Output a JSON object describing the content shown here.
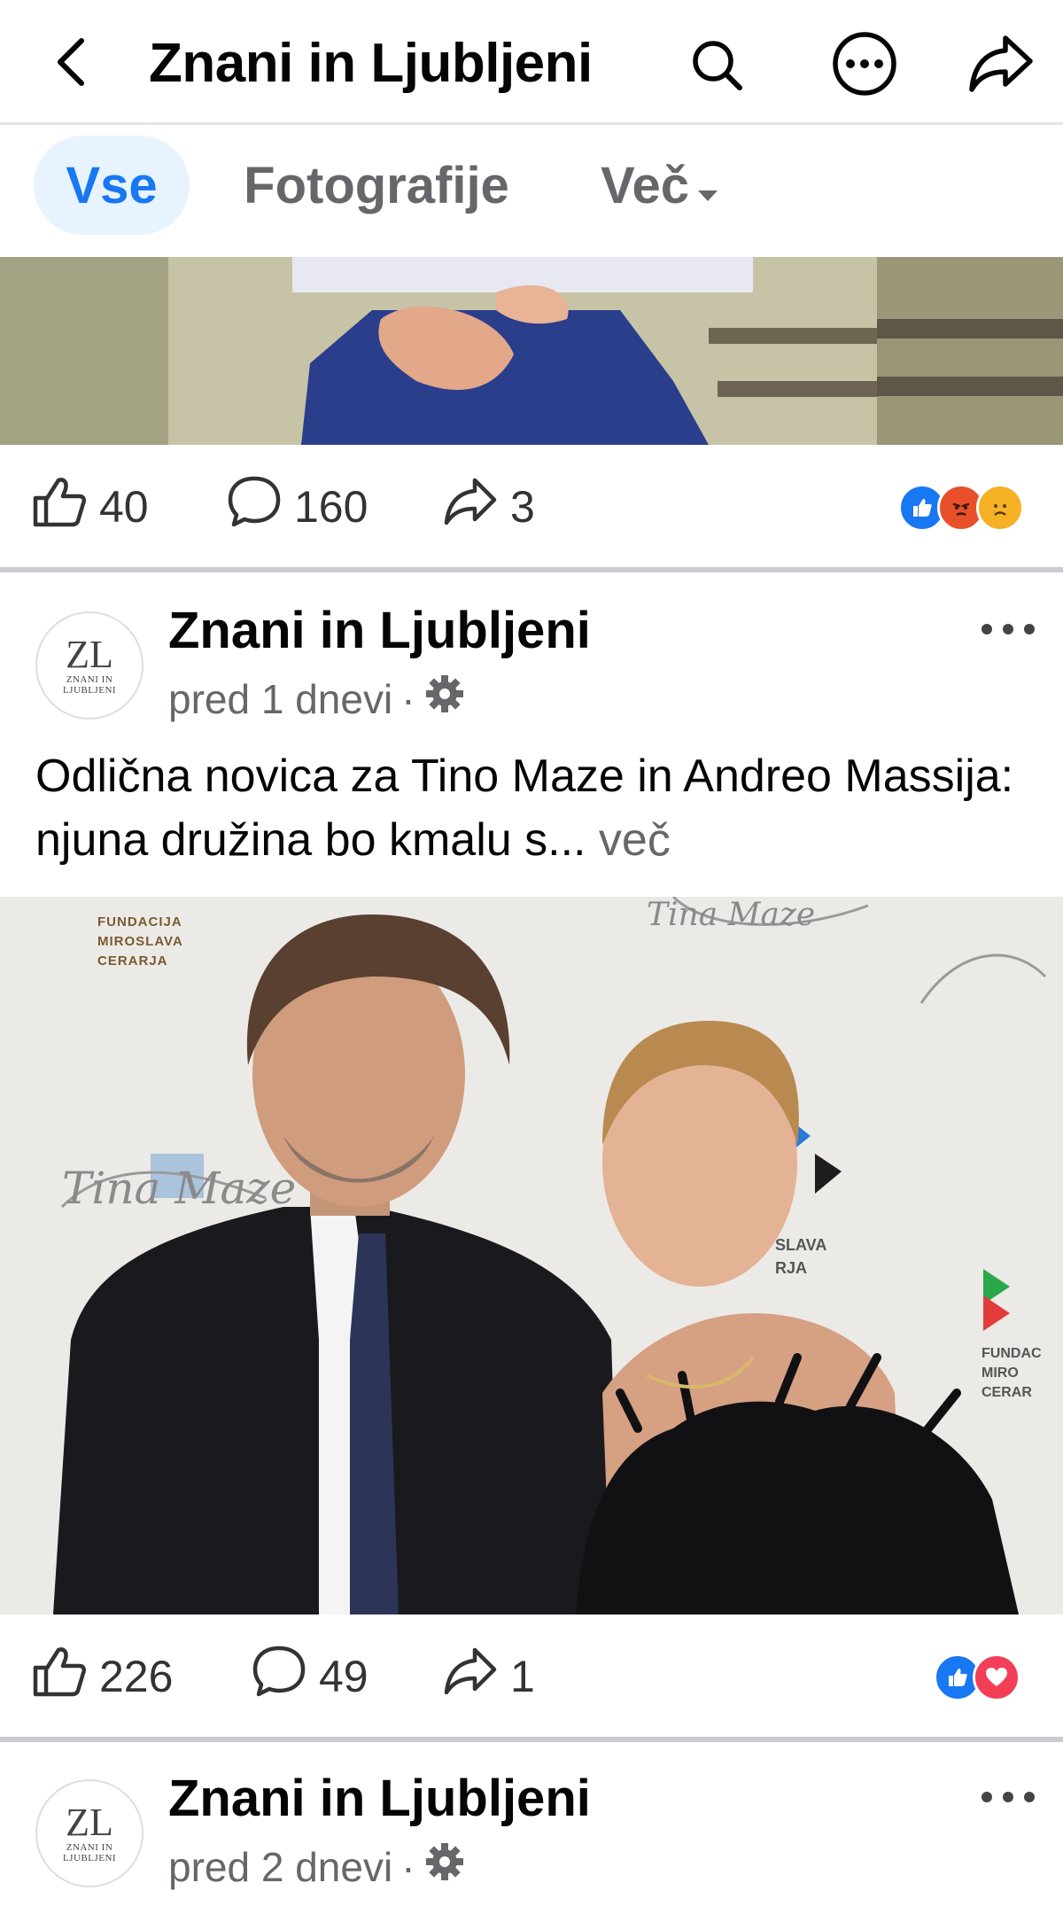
{
  "header": {
    "title": "Znani in Ljubljeni",
    "back_icon": "back-arrow-icon",
    "search_icon": "search-icon",
    "more_icon": "more-options-icon",
    "share_icon": "share-icon"
  },
  "tabs": [
    {
      "label": "Vse",
      "active": true
    },
    {
      "label": "Fotografije",
      "active": false
    },
    {
      "label": "Več",
      "active": false,
      "dropdown": true
    }
  ],
  "posts": [
    {
      "stats": {
        "likes": "40",
        "comments": "160",
        "shares": "3"
      },
      "reactions": [
        "like",
        "angry",
        "sad"
      ]
    },
    {
      "author": "Znani in Ljubljeni",
      "avatar_text": "ZL",
      "avatar_sub": "ZNANI IN LJUBLJENI",
      "time": "pred 1 dnevi",
      "separator": "·",
      "text": "Odlična novica za Tino Maze in Andreo Massija: njuna družina bo kmalu s...",
      "see_more": "več",
      "photo_texts": {
        "left_logo": "FUNDACIJA MIROSLAVA CERARJA",
        "top_sig": "Tina Maze",
        "mid_sig": "Tina Maze",
        "right_small": "SLAVA RJA",
        "right_logo": "FUNDAC MIRO CERAR"
      },
      "stats": {
        "likes": "226",
        "comments": "49",
        "shares": "1"
      },
      "reactions": [
        "like",
        "love"
      ]
    },
    {
      "author": "Znani in Ljubljeni",
      "avatar_text": "ZL",
      "avatar_sub": "ZNANI IN LJUBLJENI",
      "time": "pred 2 dnevi",
      "separator": "·"
    }
  ],
  "colors": {
    "accent": "#1877f2",
    "tab_active_bg": "#e7f3ff",
    "secondary_text": "#65676b",
    "divider": "#c9ccd1",
    "angry": "#f0732a",
    "sad": "#f7b125",
    "love": "#f33e58"
  }
}
